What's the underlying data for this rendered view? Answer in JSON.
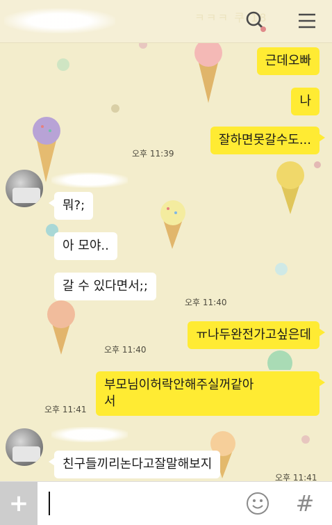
{
  "header": {
    "faded_text": "ㅋㅋㅋ 쿠 18"
  },
  "icons": {
    "search": "search-icon",
    "menu": "menu-icon",
    "plus": "plus-icon",
    "emoji": "emoji-icon",
    "hashtag": "hashtag-icon"
  },
  "messages": [
    {
      "side": "mine",
      "text": "근데오빠"
    },
    {
      "side": "mine",
      "text": "나"
    },
    {
      "side": "mine",
      "text": "잘하면못갈수도..."
    },
    {
      "side": "theirs",
      "text": "뭐?;"
    },
    {
      "side": "theirs",
      "text": "아 모야.."
    },
    {
      "side": "theirs",
      "text": "갈 수 있다면서;;"
    },
    {
      "side": "mine",
      "text": "ㅠ나두완전가고싶은데"
    },
    {
      "side": "mine",
      "text": "부모님이허락안해주실꺼같아\n서"
    },
    {
      "side": "theirs",
      "text": "친구들끼리논다고잘말해보지"
    }
  ],
  "times": {
    "t1": "오후 11:39",
    "t2": "오후 11:40",
    "t3": "오후 11:40",
    "t4": "오후 11:41",
    "t5": "오후 11:41"
  },
  "input": {
    "plus_label": "+",
    "hashtag_label": "#"
  },
  "colors": {
    "background": "#f3edcc",
    "my_bubble": "#ffeb33",
    "their_bubble": "#ffffff"
  }
}
